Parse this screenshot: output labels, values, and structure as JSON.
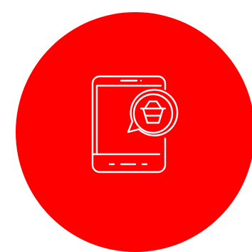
{
  "colors": {
    "background": "#ffffff",
    "circle": "#ff0000",
    "icon_stroke": "#ffffff"
  },
  "icon": {
    "name": "mobile-shopping-basket-icon"
  }
}
